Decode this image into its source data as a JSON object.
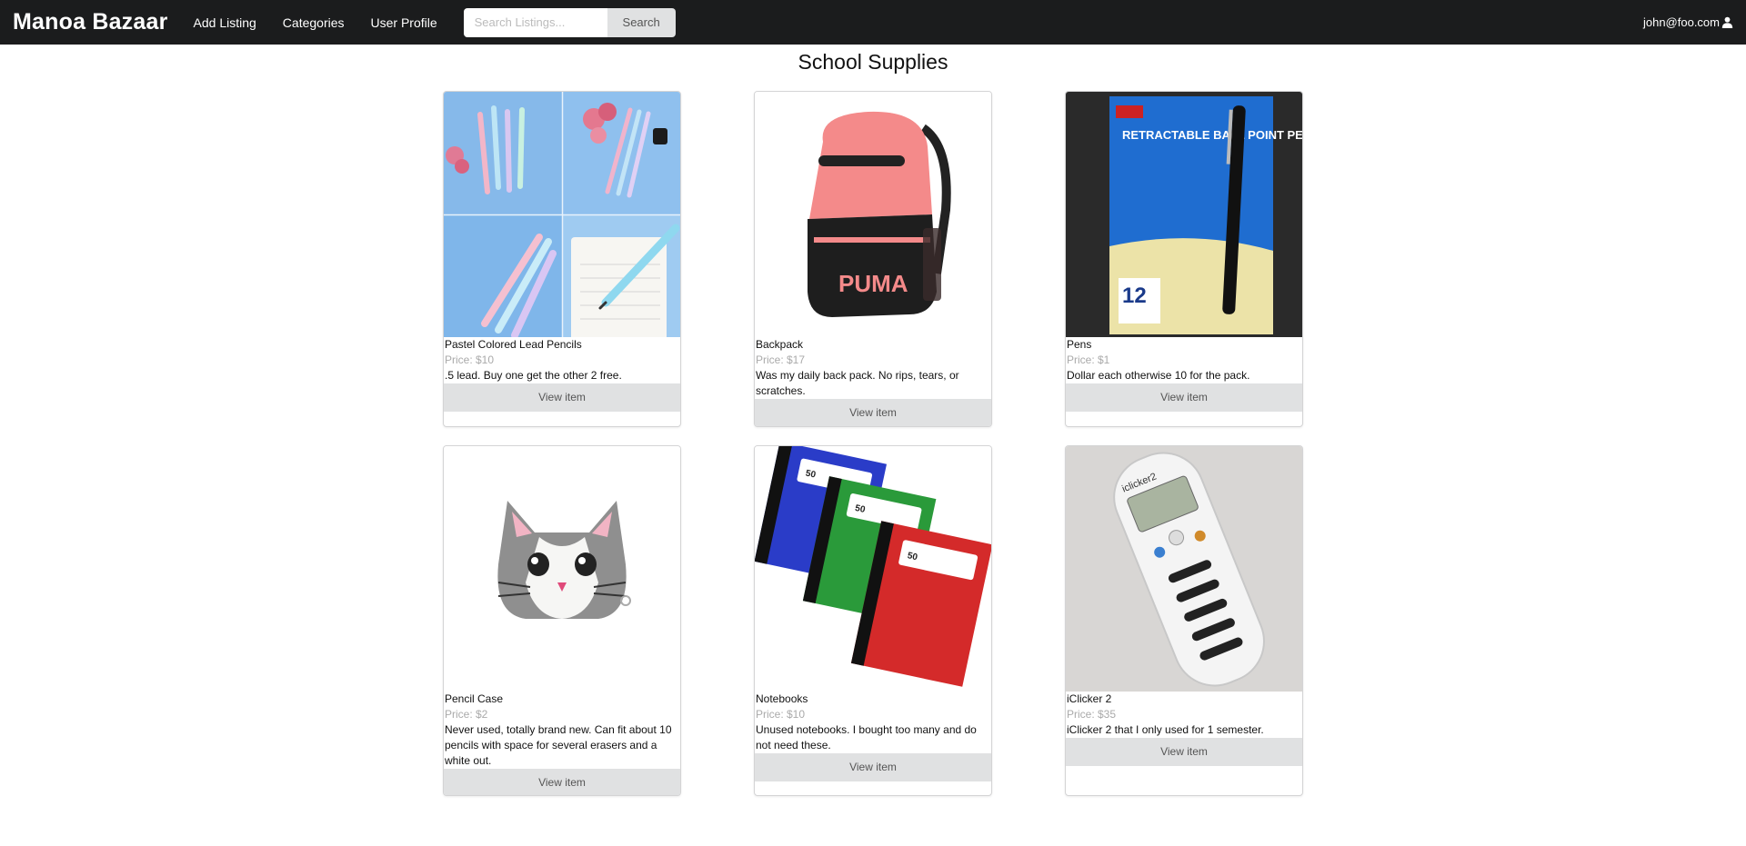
{
  "navbar": {
    "brand": "Manoa Bazaar",
    "links": [
      "Add Listing",
      "Categories",
      "User Profile"
    ],
    "search_placeholder": "Search Listings...",
    "search_button": "Search",
    "user_email": "john@foo.com"
  },
  "page": {
    "title": "School Supplies"
  },
  "items": [
    {
      "title": "Pastel Colored Lead Pencils",
      "price": "Price: $10",
      "description": ".5 lead. Buy one get the other 2 free.",
      "button": "View item"
    },
    {
      "title": "Backpack",
      "price": "Price: $17",
      "description": "Was my daily back pack. No rips, tears, or scratches.",
      "button": "View item"
    },
    {
      "title": "Pens",
      "price": "Price: $1",
      "description": "Dollar each otherwise 10 for the pack.",
      "button": "View item"
    },
    {
      "title": "Pencil Case",
      "price": "Price: $2",
      "description": "Never used, totally brand new. Can fit about 10 pencils with space for several erasers and a white out.",
      "button": "View item"
    },
    {
      "title": "Notebooks",
      "price": "Price: $10",
      "description": "Unused notebooks. I bought too many and do not need these.",
      "button": "View item"
    },
    {
      "title": "iClicker 2",
      "price": "Price: $35",
      "description": "iClicker 2 that I only used for 1 semester.",
      "button": "View item"
    }
  ],
  "image_labels": {
    "backpack_logo": "PUMA",
    "pens_box": "RETRACTABLE BALL POINT PEN",
    "pens_count": "12",
    "notebook_sheets": "50",
    "iclicker_brand": "iclicker2"
  },
  "icons": {
    "user": "user-icon"
  }
}
